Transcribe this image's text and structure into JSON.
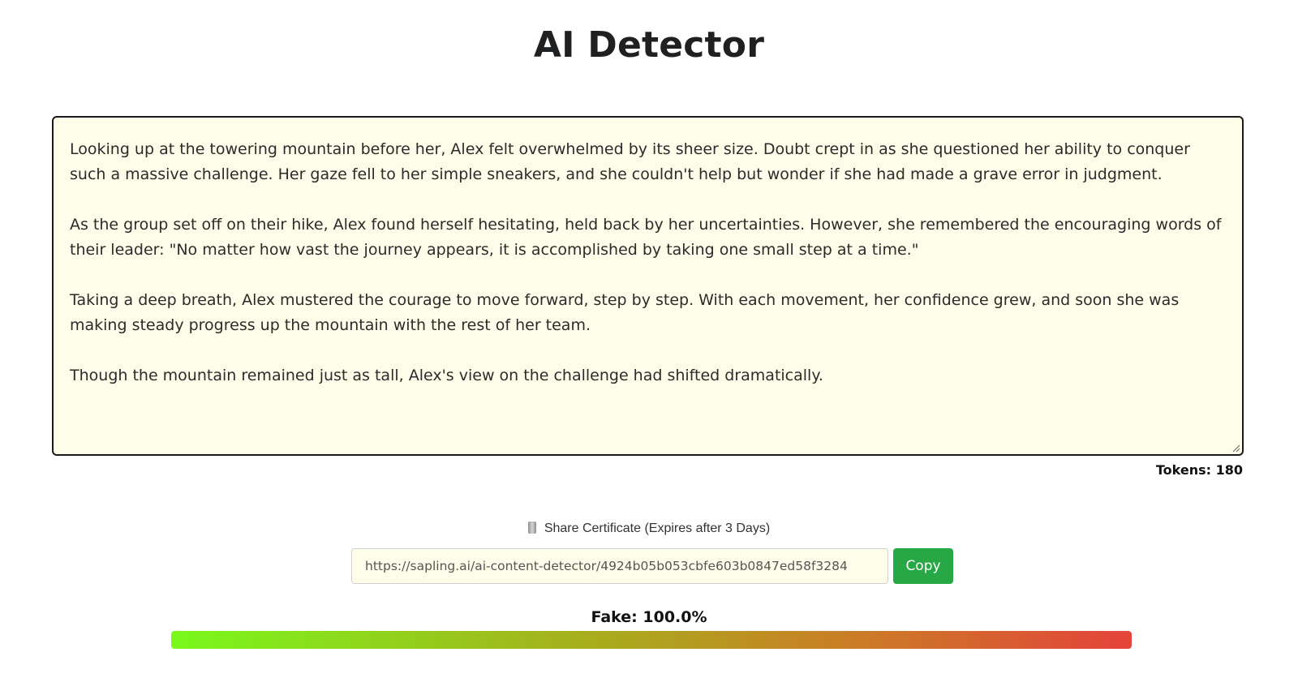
{
  "title": "AI Detector",
  "editor": {
    "paragraphs": [
      "Looking up at the towering mountain before her, Alex felt overwhelmed by its sheer size. Doubt crept in as she questioned her ability to conquer such a massive challenge. Her gaze fell to her simple sneakers, and she couldn't help but wonder if she had made a grave error in judgment.",
      "As the group set off on their hike, Alex found herself hesitating, held back by her uncertainties. However, she remembered the encouraging words of their leader: \"No matter how vast the journey appears, it is accomplished by taking one small step at a time.\"",
      "Taking a deep breath, Alex mustered the courage to move forward, step by step. With each movement, her confidence grew, and soon she was making steady progress up the mountain with the rest of her team.",
      "Though the mountain remained just as tall, Alex's view on the challenge had shifted dramatically."
    ],
    "tokens_label": "Tokens: 180"
  },
  "share": {
    "icon": "scroll-icon",
    "label": "Share Certificate (Expires after 3 Days)",
    "url": "https://sapling.ai/ai-content-detector/4924b05b053cbfe603b0847ed58f3284",
    "copy_label": "Copy"
  },
  "result": {
    "label": "Fake: 100.0%",
    "fake_fraction": 1.0
  },
  "colors": {
    "copy_button": "#28a745",
    "editor_background": "#fefde9",
    "meter_start": "#79f91b",
    "meter_end": "#e4433a"
  }
}
